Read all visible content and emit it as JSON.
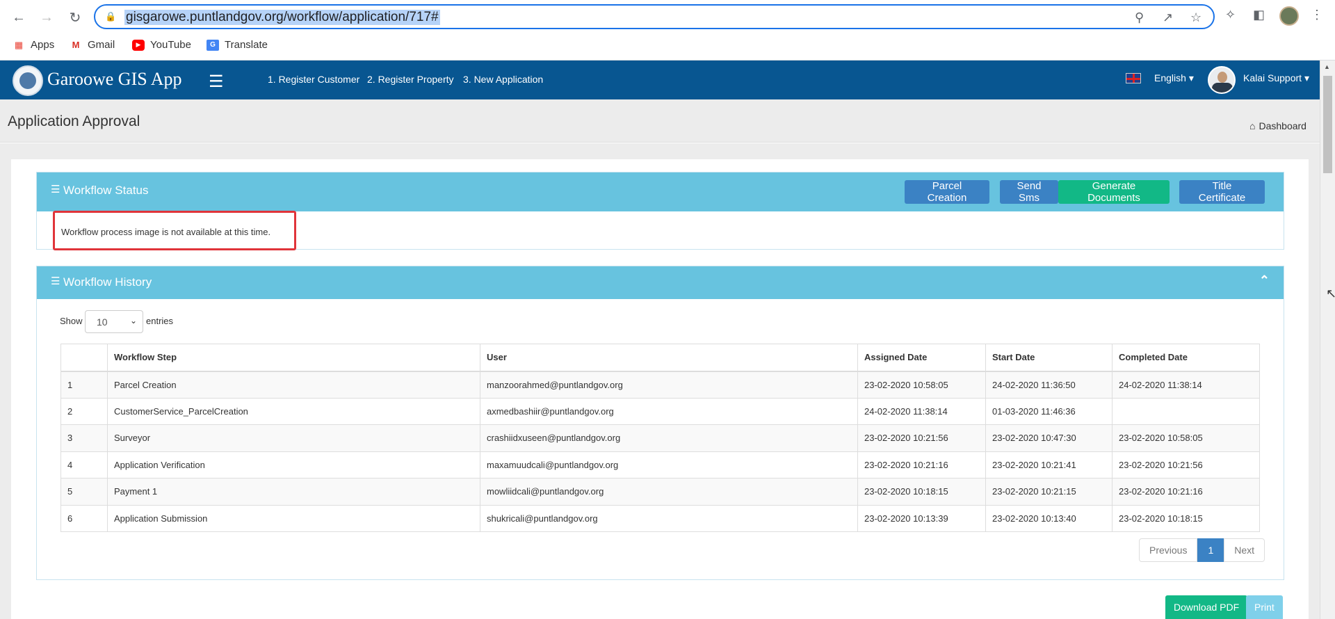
{
  "browser": {
    "url": "gisgarowe.puntlandgov.org/workflow/application/717#",
    "bookmarks": [
      "Apps",
      "Gmail",
      "YouTube",
      "Translate"
    ]
  },
  "header": {
    "app_title": "Garoowe GIS App",
    "nav": [
      "1. Register Customer",
      "2. Register Property",
      "3. New Application"
    ],
    "language": "English",
    "user": "Kalai Support"
  },
  "page": {
    "title": "Application Approval",
    "breadcrumb": "Dashboard"
  },
  "workflow_status": {
    "title": "Workflow Status",
    "buttons": [
      "Parcel Creation",
      "Send Sms",
      "Generate Documents",
      "Title Certificate"
    ],
    "message": "Workflow process image is not available at this time."
  },
  "workflow_history": {
    "title": "Workflow History",
    "show_label": "Show",
    "entries_value": "10",
    "entries_label": "entries",
    "columns": [
      "",
      "Workflow Step",
      "User",
      "Assigned Date",
      "Start Date",
      "Completed Date"
    ],
    "rows": [
      [
        "1",
        "Parcel Creation",
        "manzoorahmed@puntlandgov.org",
        "23-02-2020 10:58:05",
        "24-02-2020 11:36:50",
        "24-02-2020 11:38:14"
      ],
      [
        "2",
        "CustomerService_ParcelCreation",
        "axmedbashiir@puntlandgov.org",
        "24-02-2020 11:38:14",
        "01-03-2020 11:46:36",
        ""
      ],
      [
        "3",
        "Surveyor",
        "crashiidxuseen@puntlandgov.org",
        "23-02-2020 10:21:56",
        "23-02-2020 10:47:30",
        "23-02-2020 10:58:05"
      ],
      [
        "4",
        "Application Verification",
        "maxamuudcali@puntlandgov.org",
        "23-02-2020 10:21:16",
        "23-02-2020 10:21:41",
        "23-02-2020 10:21:56"
      ],
      [
        "5",
        "Payment 1",
        "mowliidcali@puntlandgov.org",
        "23-02-2020 10:18:15",
        "23-02-2020 10:21:15",
        "23-02-2020 10:21:16"
      ],
      [
        "6",
        "Application Submission",
        "shukricali@puntlandgov.org",
        "23-02-2020 10:13:39",
        "23-02-2020 10:13:40",
        "23-02-2020 10:18:15"
      ]
    ],
    "pagination": {
      "previous": "Previous",
      "current": "1",
      "next": "Next"
    }
  },
  "footer_buttons": {
    "download": "Download PDF",
    "print": "Print"
  },
  "colors": {
    "header": "#085691",
    "panel": "#67c3df",
    "btn_blue": "#3b82c4",
    "btn_green": "#12b886",
    "highlight": "#e0343a"
  }
}
